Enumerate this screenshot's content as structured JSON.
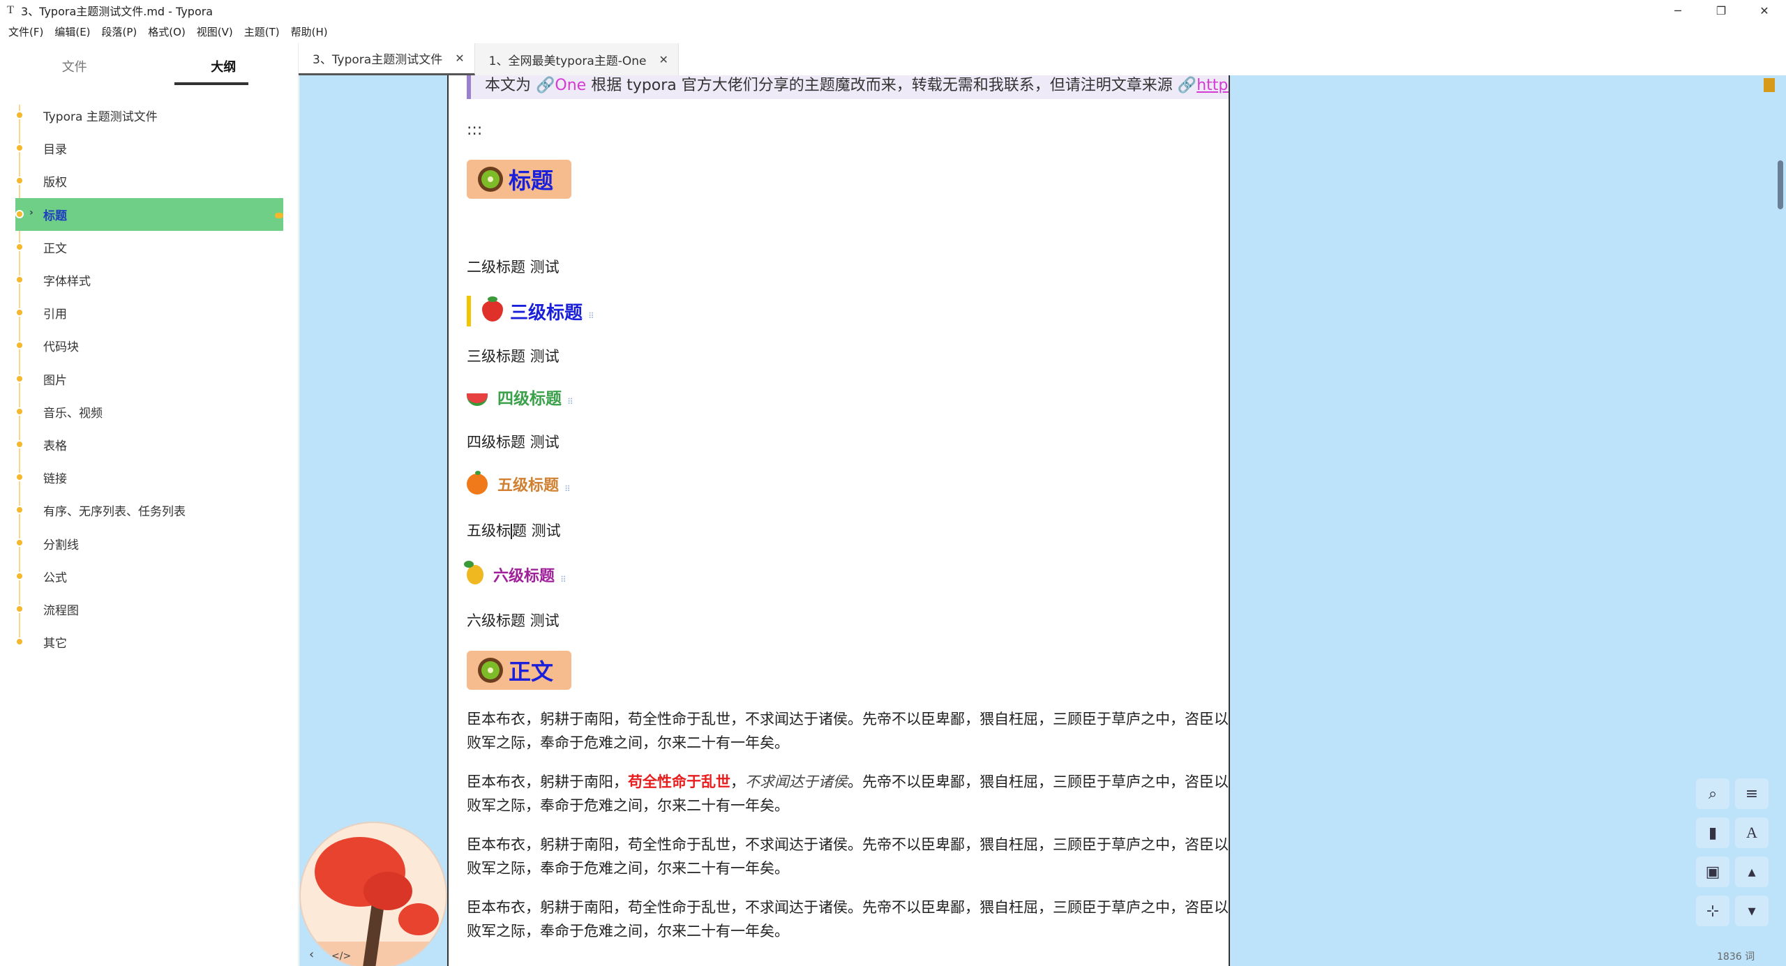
{
  "window": {
    "app_glyph": "T",
    "title": "3、Typora主题测试文件.md - Typora",
    "controls": {
      "minimize": "─",
      "restore": "❐",
      "close": "✕"
    }
  },
  "menubar": [
    "文件(F)",
    "编辑(E)",
    "段落(P)",
    "格式(O)",
    "视图(V)",
    "主题(T)",
    "帮助(H)"
  ],
  "sidebar": {
    "tabs": {
      "files": "文件",
      "outline": "大纲"
    },
    "outline_items": [
      "Typora 主题测试文件",
      "目录",
      "版权",
      "标题",
      "正文",
      "字体样式",
      "引用",
      "代码块",
      "图片",
      "音乐、视频",
      "表格",
      "链接",
      "有序、无序列表、任务列表",
      "分割线",
      "公式",
      "流程图",
      "其它"
    ],
    "active_index": 3
  },
  "file_tabs": [
    {
      "label": "3、Typora主题测试文件",
      "close": "✕"
    },
    {
      "label": "1、全网最美typora主题-One",
      "close": "✕"
    }
  ],
  "doc": {
    "quote": {
      "prefix": "本文为 ",
      "link_one": "One",
      "middle": " 根据 typora 官方大佬们分享的主题魔改而来，转载无需和我联系，但请注明文章来源 ",
      "url": "https://onedayxyy.cn/"
    },
    "triple": ":::",
    "h2_title": "标题",
    "h2_test": "二级标题 测试",
    "h3_title": "三级标题",
    "h3_test": "三级标题 测试",
    "h4_title": "四级标题",
    "h4_test": "四级标题 测试",
    "h5_title": "五级标题",
    "h5_test_a": "五级标",
    "h5_test_b": "题 测试",
    "h6_title": "六级标题",
    "h6_test": "六级标题 测试",
    "h2_body": "正文",
    "body_para": "臣本布衣，躬耕于南阳，苟全性命于乱世，不求闻达于诸侯。先帝不以臣卑鄙，猥自枉屈，三顾臣于草庐之中，咨臣以当世之事，由是感激，遂许先帝以驱驰。后值倾覆，受任于败军之际，奉命于危难之间，尔来二十有一年矣。",
    "styled_para": {
      "a": "臣本布衣，躬耕于南阳，",
      "bold": "苟全性命于乱世",
      "b": "，",
      "italic": "不求闻达于诸侯",
      "c": "。先帝不以臣卑鄙，猥自枉屈，三顾臣于草庐之中，咨臣以当世之事，由是感激，遂许先帝以驱驰。后值倾覆，受任于败军之际，奉命于危难之间，尔来二十有一年矣。"
    }
  },
  "footer": {
    "sidebar_toggle": "‹",
    "source_toggle": "</>",
    "word_count": "1836 词"
  },
  "tools": {
    "search": "search-icon",
    "outline": "list-icon",
    "bookmark": "bookmark-icon",
    "font": "font-icon",
    "image": "image-icon",
    "up": "arrow-up-icon",
    "tree": "sitemap-icon",
    "down": "arrow-down-icon"
  },
  "colors": {
    "accent": "#6fcf87",
    "background": "#bde3fb",
    "heading_blue": "#1a1fd9",
    "outline_dot": "#f5b72b"
  }
}
